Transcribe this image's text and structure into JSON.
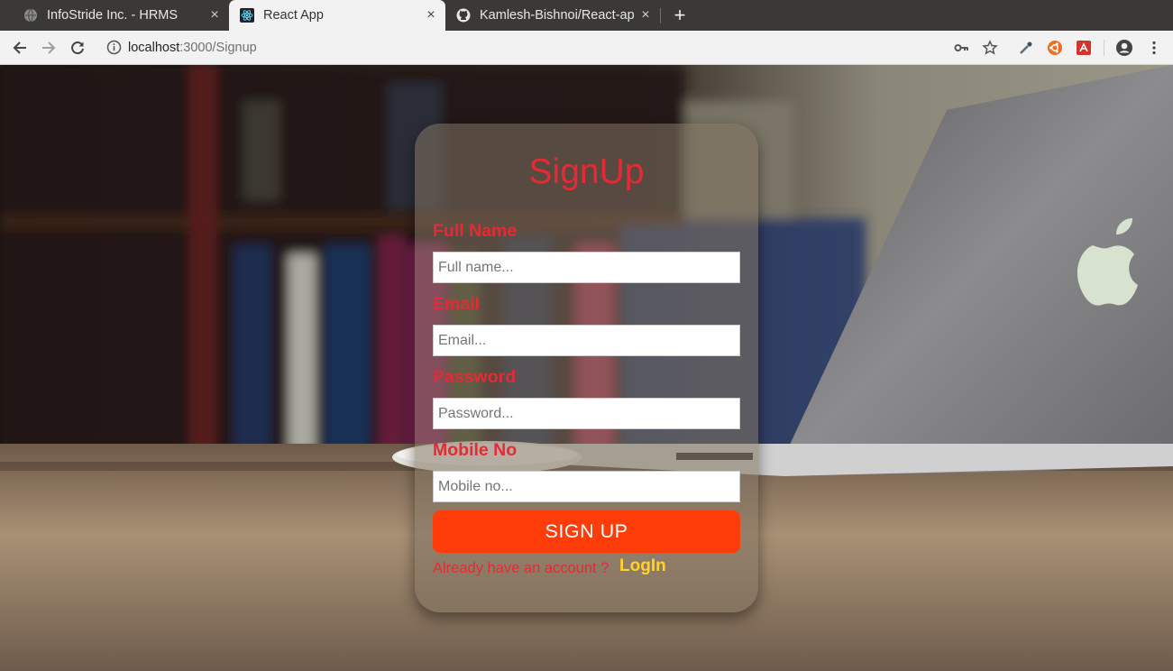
{
  "browser": {
    "tabs": [
      {
        "title": "InfoStride Inc. - HRMS",
        "active": false,
        "icon": "globe-icon"
      },
      {
        "title": "React App",
        "active": true,
        "icon": "react-icon"
      },
      {
        "title": "Kamlesh-Bishnoi/React-ap",
        "active": false,
        "icon": "github-icon"
      }
    ],
    "close_symbol": "×",
    "new_tab_symbol": "+",
    "url_host": "localhost",
    "url_path": ":3000/Signup"
  },
  "form": {
    "title": "SignUp",
    "fields": [
      {
        "label": "Full Name",
        "placeholder": "Full name..."
      },
      {
        "label": "Email",
        "placeholder": "Email..."
      },
      {
        "label": "Password",
        "placeholder": "Password..."
      },
      {
        "label": "Mobile No",
        "placeholder": "Mobile no..."
      }
    ],
    "submit_label": "SIGN UP",
    "already_text": "Already have an account ?",
    "login_label": "LogIn"
  },
  "colors": {
    "accent_red": "#e62a35",
    "button_orange": "#fe3d0b",
    "login_yellow": "#ffd32a"
  }
}
